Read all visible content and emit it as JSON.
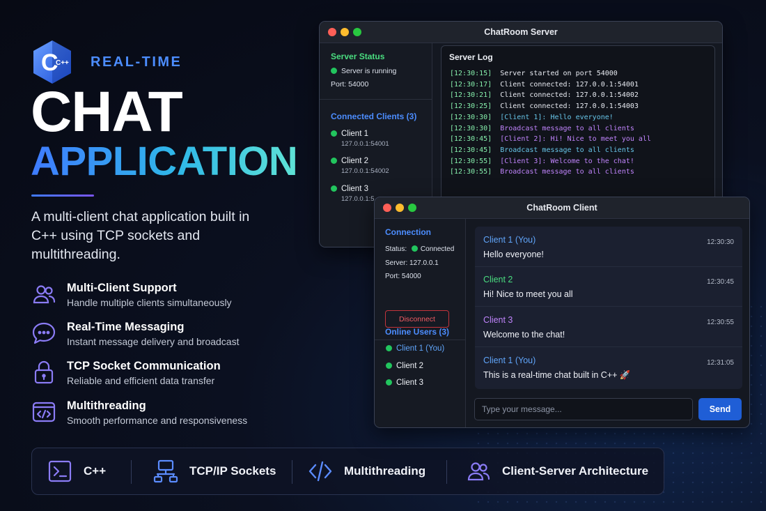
{
  "hero": {
    "logo_text": "C++",
    "tagline": "REAL-TIME",
    "title_line1": "CHAT",
    "title_line2": "APPLICATION",
    "description": "A multi-client chat application built in C++ using TCP sockets and multithreading.",
    "features": [
      {
        "icon": "users-icon",
        "title": "Multi-Client Support",
        "desc": "Handle multiple clients simultaneously"
      },
      {
        "icon": "chat-bubble-icon",
        "title": "Real-Time Messaging",
        "desc": "Instant message delivery and broadcast"
      },
      {
        "icon": "lock-icon",
        "title": "TCP Socket Communication",
        "desc": "Reliable and efficient data transfer"
      },
      {
        "icon": "code-window-icon",
        "title": "Multithreading",
        "desc": "Smooth performance and responsiveness"
      }
    ]
  },
  "techbar": [
    {
      "icon": "terminal-icon",
      "label": "C++"
    },
    {
      "icon": "network-icon",
      "label": "TCP/IP Sockets"
    },
    {
      "icon": "code-brackets-icon",
      "label": "Multithreading"
    },
    {
      "icon": "users-icon",
      "label": "Client-Server Architecture"
    }
  ],
  "server_window": {
    "title": "ChatRoom Server",
    "status_title": "Server Status",
    "status_text": "Server is running",
    "port_text": "Port: 54000",
    "clients_title": "Connected Clients (3)",
    "clients": [
      {
        "name": "Client 1",
        "addr": "127.0.0.1:54001"
      },
      {
        "name": "Client 2",
        "addr": "127.0.0.1:54002"
      },
      {
        "name": "Client 3",
        "addr": "127.0.0.1:5"
      }
    ],
    "log_title": "Server Log",
    "log": [
      {
        "ts": "[12:30:15]",
        "msg": "Server started on port 54000",
        "kind": "white"
      },
      {
        "ts": "[12:30:17]",
        "msg": "Client connected: 127.0.0.1:54001",
        "kind": "white"
      },
      {
        "ts": "[12:30:21]",
        "msg": "Client connected: 127.0.0.1:54002",
        "kind": "white"
      },
      {
        "ts": "[12:30:25]",
        "msg": "Client connected: 127.0.0.1:54003",
        "kind": "white"
      },
      {
        "ts": "[12:30:30]",
        "msg": "[Client 1]: Hello everyone!",
        "kind": "cyan"
      },
      {
        "ts": "[12:30:30]",
        "msg": "Broadcast message to all clients",
        "kind": "purple"
      },
      {
        "ts": "[12:30:45]",
        "msg": "[Client 2]: Hi! Nice to meet you all",
        "kind": "purple"
      },
      {
        "ts": "[12:30:45]",
        "msg": "Broadcast message to all clients",
        "kind": "cyan"
      },
      {
        "ts": "[12:30:55]",
        "msg": "[Client 3]: Welcome to the chat!",
        "kind": "purple"
      },
      {
        "ts": "[12:30:55]",
        "msg": "Broadcast message to all clients",
        "kind": "purple"
      }
    ]
  },
  "client_window": {
    "title": "ChatRoom Client",
    "connection_title": "Connection",
    "status_label": "Status:",
    "status_value": "Connected",
    "server_text": "Server: 127.0.0.1",
    "port_text": "Port: 54000",
    "disconnect_label": "Disconnect",
    "users_title": "Online Users (3)",
    "users": [
      "Client 1 (You)",
      "Client 2",
      "Client 3"
    ],
    "messages": [
      {
        "sender": "Client 1 (You)",
        "time": "12:30:30",
        "text": "Hello everyone!",
        "color": "c1"
      },
      {
        "sender": "Client 2",
        "time": "12:30:45",
        "text": "Hi! Nice to meet you all",
        "color": "c2"
      },
      {
        "sender": "Client 3",
        "time": "12:30:55",
        "text": "Welcome to the chat!",
        "color": "c3"
      },
      {
        "sender": "Client 1 (You)",
        "time": "12:31:05",
        "text": "This is a real-time chat built in C++ 🚀",
        "color": "c1"
      }
    ],
    "input_placeholder": "Type your message...",
    "send_label": "Send"
  },
  "colors": {
    "accent_blue": "#4c8dff",
    "accent_purple": "#7a55f0",
    "online_green": "#22c55e",
    "send_button": "#1f5ed6",
    "disconnect_red": "#c3343c"
  }
}
